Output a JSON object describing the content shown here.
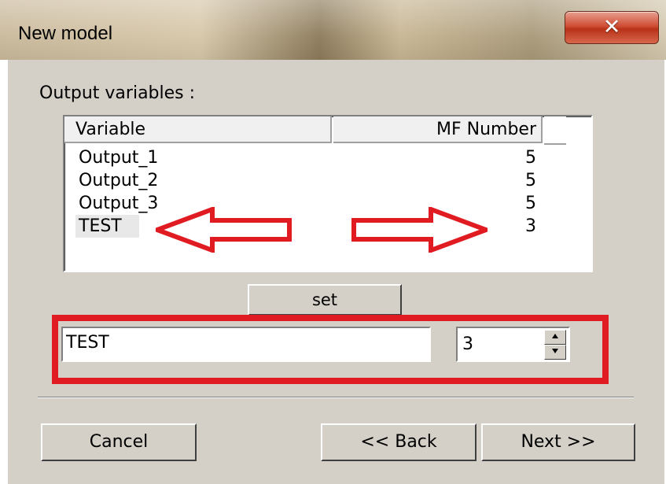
{
  "window": {
    "title": "New model",
    "close_glyph": "✕"
  },
  "section_label": "Output variables :",
  "table": {
    "columns": [
      "Variable",
      "MF Number"
    ],
    "rows": [
      {
        "name": "Output_1",
        "mf": "5"
      },
      {
        "name": "Output_2",
        "mf": "5"
      },
      {
        "name": "Output_3",
        "mf": "5"
      },
      {
        "name": "TEST",
        "mf": "3"
      }
    ],
    "selected_row": 3
  },
  "set_button": "set",
  "editor": {
    "name_value": "TEST",
    "mf_value": "3"
  },
  "buttons": {
    "cancel": "Cancel",
    "back": "<< Back",
    "next": "Next >>"
  },
  "colors": {
    "annotation_red": "#e11b22",
    "dialog_bg": "#d4d0c8"
  },
  "icons": {
    "spin_up": "spin-up-icon",
    "spin_down": "spin-down-icon",
    "close": "close-icon"
  }
}
